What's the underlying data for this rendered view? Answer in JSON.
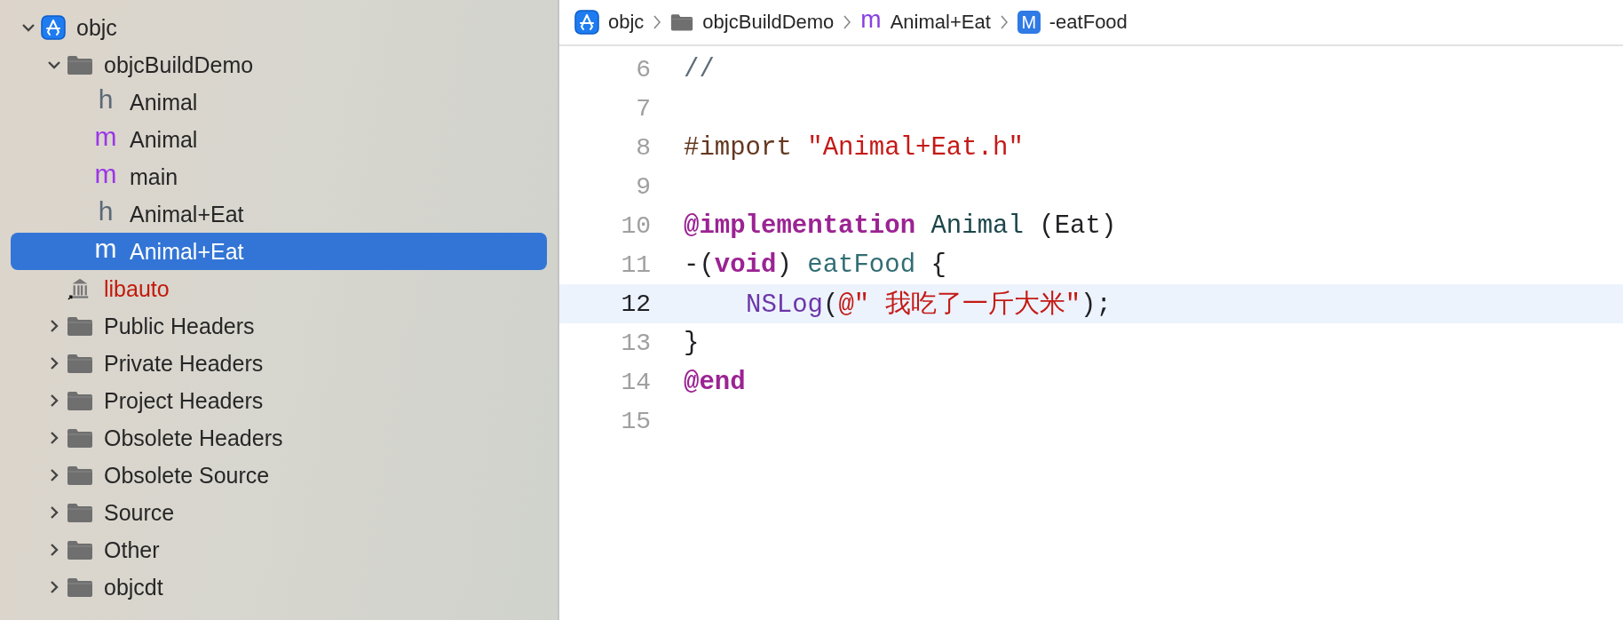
{
  "navigator": {
    "items": [
      {
        "label": "objc",
        "kind": "project",
        "expanded": true,
        "selected": false,
        "missing": false,
        "children": [
          {
            "label": "objcBuildDemo",
            "kind": "folder",
            "expanded": true,
            "selected": false,
            "missing": false,
            "children": [
              {
                "label": "Animal",
                "kind": "header",
                "icon_text": "h",
                "selected": false,
                "missing": false
              },
              {
                "label": "Animal",
                "kind": "source",
                "icon_text": "m",
                "selected": false,
                "missing": false
              },
              {
                "label": "main",
                "kind": "source",
                "icon_text": "m",
                "selected": false,
                "missing": false
              },
              {
                "label": "Animal+Eat",
                "kind": "header",
                "icon_text": "h",
                "selected": false,
                "missing": false
              },
              {
                "label": "Animal+Eat",
                "kind": "source",
                "icon_text": "m",
                "selected": true,
                "missing": false
              }
            ]
          },
          {
            "label": "libauto",
            "kind": "library",
            "selected": false,
            "missing": true
          },
          {
            "label": "Public Headers",
            "kind": "folder",
            "expanded": false,
            "selected": false,
            "missing": false
          },
          {
            "label": "Private Headers",
            "kind": "folder",
            "expanded": false,
            "selected": false,
            "missing": false
          },
          {
            "label": "Project Headers",
            "kind": "folder",
            "expanded": false,
            "selected": false,
            "missing": false
          },
          {
            "label": "Obsolete Headers",
            "kind": "folder",
            "expanded": false,
            "selected": false,
            "missing": false
          },
          {
            "label": "Obsolete Source",
            "kind": "folder",
            "expanded": false,
            "selected": false,
            "missing": false
          },
          {
            "label": "Source",
            "kind": "folder",
            "expanded": false,
            "selected": false,
            "missing": false
          },
          {
            "label": "Other",
            "kind": "folder",
            "expanded": false,
            "selected": false,
            "missing": false
          },
          {
            "label": "objcdt",
            "kind": "folder",
            "expanded": false,
            "selected": false,
            "missing": false
          }
        ]
      }
    ]
  },
  "breadcrumb": [
    {
      "label": "objc",
      "kind": "project"
    },
    {
      "label": "objcBuildDemo",
      "kind": "folder"
    },
    {
      "label": "Animal+Eat",
      "kind": "source",
      "icon_text": "m"
    },
    {
      "label": "-eatFood",
      "kind": "method",
      "icon_text": "M"
    }
  ],
  "editor": {
    "lines": [
      {
        "number": "6",
        "current": false,
        "tokens": [
          {
            "kind": "comment",
            "text": "//"
          }
        ]
      },
      {
        "number": "7",
        "current": false
      },
      {
        "number": "8",
        "current": false,
        "tokens": [
          {
            "kind": "preprocessor",
            "text": "#import "
          },
          {
            "kind": "string",
            "text": "\"Animal+Eat.h\""
          }
        ]
      },
      {
        "number": "9",
        "current": false
      },
      {
        "number": "10",
        "current": false,
        "tokens": [
          {
            "kind": "keyword",
            "text": "@implementation "
          },
          {
            "kind": "type",
            "text": "Animal"
          },
          {
            "kind": "plain",
            "text": " (Eat)"
          }
        ]
      },
      {
        "number": "11",
        "current": false,
        "tokens": [
          {
            "kind": "plain",
            "text": "-("
          },
          {
            "kind": "keyword",
            "text": "void"
          },
          {
            "kind": "plain",
            "text": ") "
          },
          {
            "kind": "function",
            "text": "eatFood"
          },
          {
            "kind": "plain",
            "text": " {"
          }
        ]
      },
      {
        "number": "12",
        "current": true,
        "indented": true,
        "tokens": [
          {
            "kind": "call",
            "text": "NSLog"
          },
          {
            "kind": "plain",
            "text": "("
          },
          {
            "kind": "string",
            "text": "@\" 我吃了一斤大米\""
          },
          {
            "kind": "plain",
            "text": ");"
          }
        ]
      },
      {
        "number": "13",
        "current": false,
        "tokens": [
          {
            "kind": "plain",
            "text": "}"
          }
        ]
      },
      {
        "number": "14",
        "current": false,
        "tokens": [
          {
            "kind": "keyword",
            "text": "@end"
          }
        ]
      },
      {
        "number": "15",
        "current": false
      }
    ]
  }
}
